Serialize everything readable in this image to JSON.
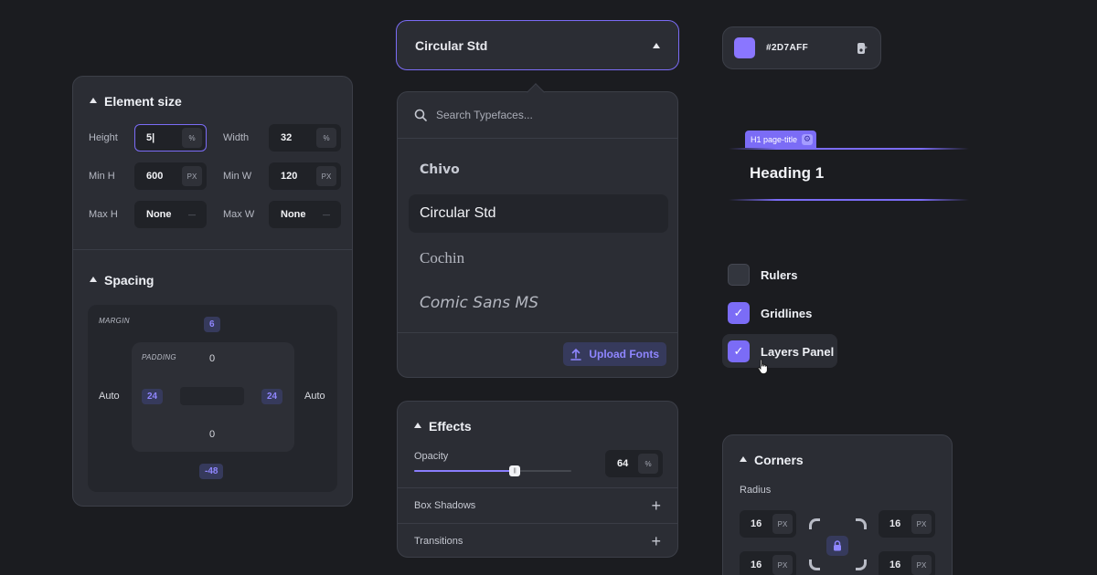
{
  "element_size": {
    "title": "Element size",
    "fields": [
      {
        "label": "Height",
        "value": "5|",
        "unit": "%"
      },
      {
        "label": "Width",
        "value": "32",
        "unit": "%"
      },
      {
        "label": "Min H",
        "value": "600",
        "unit": "PX"
      },
      {
        "label": "Min W",
        "value": "120",
        "unit": "PX"
      },
      {
        "label": "Max H",
        "value": "None",
        "unit": "—"
      },
      {
        "label": "Max W",
        "value": "None",
        "unit": "—"
      }
    ]
  },
  "spacing": {
    "title": "Spacing",
    "margin_label": "MARGIN",
    "padding_label": "PADDING",
    "margin": {
      "top": "6",
      "right": "Auto",
      "bottom": "-48",
      "left": "Auto"
    },
    "padding": {
      "top": "0",
      "right": "24",
      "bottom": "0",
      "left": "24"
    }
  },
  "font_select": {
    "value": "Circular Std",
    "search_placeholder": "Search Typefaces...",
    "fonts": [
      "Chivo",
      "Circular Std",
      "Cochin",
      "Comic Sans MS"
    ],
    "selected": "Circular Std",
    "upload_label": "Upload Fonts"
  },
  "effects": {
    "title": "Effects",
    "opacity_label": "Opacity",
    "opacity_value": "64",
    "opacity_unit": "%",
    "opacity_fraction": 0.64,
    "rows": [
      "Box Shadows",
      "Transitions"
    ]
  },
  "color": {
    "hex": "#2D7AFF",
    "swatch": "#8a76ff"
  },
  "heading": {
    "tag": "H1 page-title",
    "text": "Heading 1"
  },
  "view_options": [
    {
      "label": "Rulers",
      "checked": false
    },
    {
      "label": "Gridlines",
      "checked": true
    },
    {
      "label": "Layers Panel",
      "checked": true
    }
  ],
  "corners": {
    "title": "Corners",
    "radius_label": "Radius",
    "values": [
      {
        "value": "16",
        "unit": "PX"
      },
      {
        "value": "16",
        "unit": "PX"
      },
      {
        "value": "16",
        "unit": "PX"
      },
      {
        "value": "16",
        "unit": "PX"
      }
    ]
  },
  "accent": "#7b6cf6"
}
